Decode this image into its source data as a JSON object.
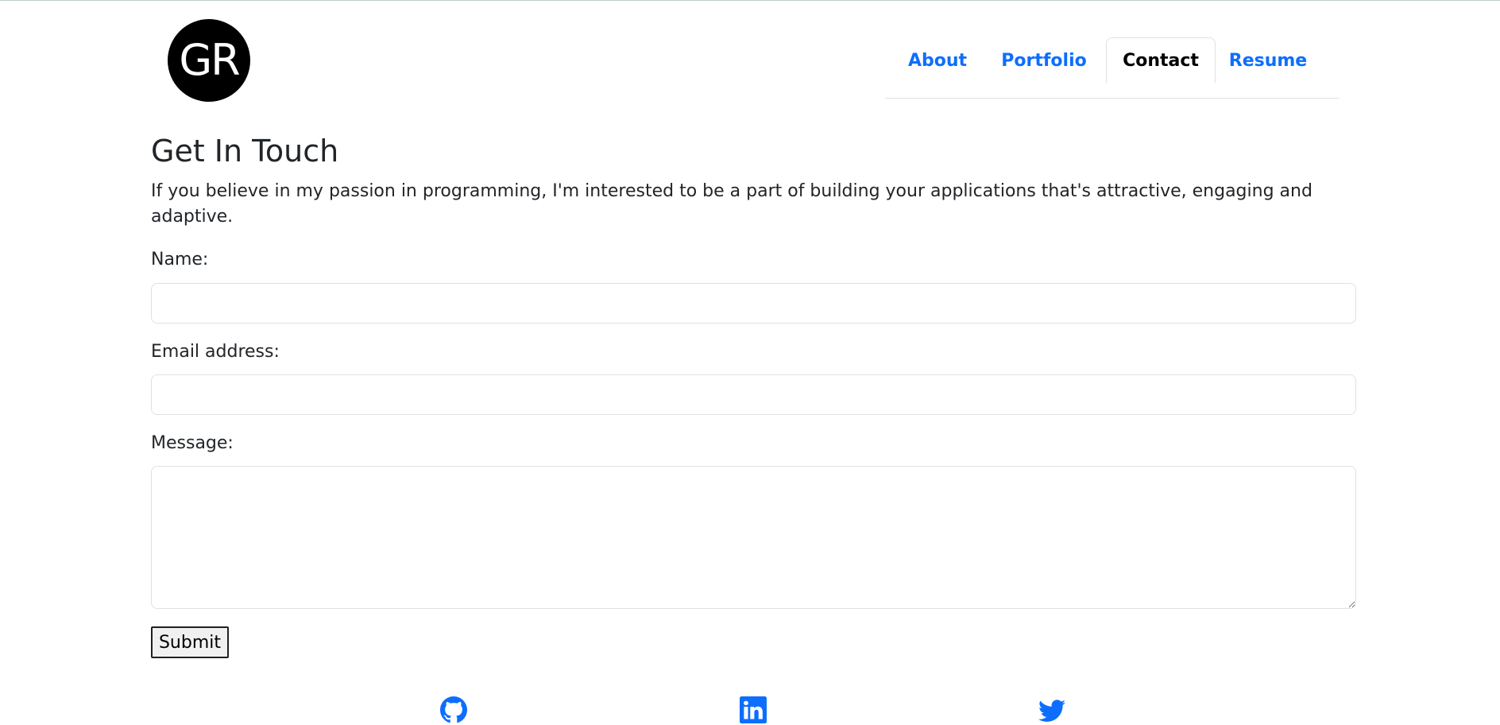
{
  "header": {
    "logo_text": "GR",
    "nav": [
      {
        "label": "About",
        "active": false
      },
      {
        "label": "Portfolio",
        "active": false
      },
      {
        "label": "Contact",
        "active": true
      },
      {
        "label": "Resume",
        "active": false
      }
    ]
  },
  "main": {
    "title": "Get In Touch",
    "intro": "If you believe in my passion in programming, I'm interested to be a part of building your applications that's attractive, engaging and adaptive.",
    "form": {
      "name_label": "Name:",
      "name_value": "",
      "email_label": "Email address:",
      "email_value": "",
      "message_label": "Message:",
      "message_value": "",
      "submit_label": "Submit"
    }
  },
  "footer": {
    "social": [
      {
        "icon": "github-icon"
      },
      {
        "icon": "linkedin-icon"
      },
      {
        "icon": "twitter-icon"
      }
    ]
  },
  "colors": {
    "link": "#0d6efd",
    "active_tab": "#000000",
    "border": "#dee2e6"
  }
}
